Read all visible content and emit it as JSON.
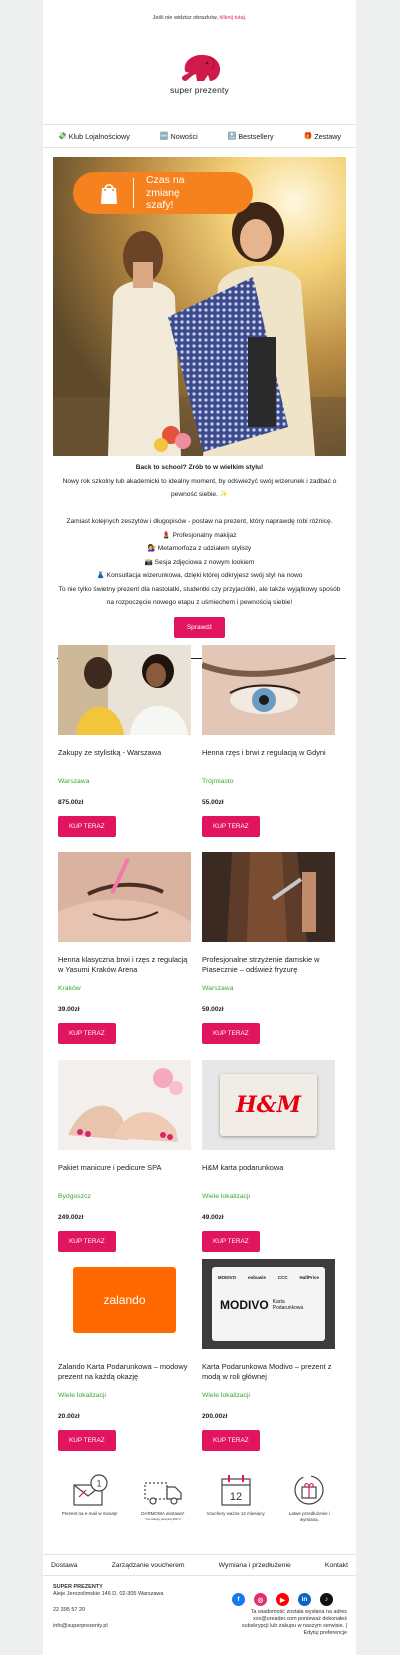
{
  "preheader": {
    "text": "Jeśli nie widzisz obrazków,",
    "link": "kliknij tutaj."
  },
  "brand": {
    "name": "super prezenty"
  },
  "nav": [
    {
      "icon": "💸",
      "label": "Klub Lojalnościowy"
    },
    {
      "icon": "🆕",
      "label": "Nowości"
    },
    {
      "icon": "🔝",
      "label": "Bestsellery"
    },
    {
      "icon": "🎁",
      "label": "Zestawy"
    }
  ],
  "hero": {
    "headline": "Czas na zmianę szafy!"
  },
  "intro": {
    "heading": "Back to school? Zrób to w wielkim stylu!",
    "p1": "Nowy rok szkolny lub akademicki to idealny moment, by odświeżyć swój wizerunek i zadbać o pewność siebie. ✨",
    "p2": "Zamiast kolejnych zeszytów i długopisów - postaw na prezent, który naprawdę robi różnicę.",
    "items": [
      "💄 Profesjonalny makijaż",
      "💇‍♀️ Metamorfoza z udziałem stylisty",
      "📸 Sesja zdjęciowa z nowym lookiem",
      "👗 Konsultacja wizerunkowa, dzięki której odkryjesz swój styl na nowo"
    ],
    "p3": "To nie tylko świetny prezent dla nastolatki, studentki czy przyjaciółki, ale  także wyjątkowy sposób na rozpoczęcie nowego etapu z uśmiechem i pewnością siebie!",
    "cta": "Sprawdź"
  },
  "products": [
    {
      "title": "Zakupy ze stylistką - Warszawa",
      "location": "Warszawa",
      "price": "875.00zł",
      "cta": "KUP TERAZ"
    },
    {
      "title": "Henna rzęs i brwi z regulacją w Gdyni",
      "location": "Trójmiasto",
      "price": "55.00zł",
      "cta": "KUP TERAZ"
    },
    {
      "title": "Henna klasyczna brwi i rzęs z regulacją w Yasumi Kraków Arena",
      "location": "Kraków",
      "price": "39.00zł",
      "cta": "KUP TERAZ"
    },
    {
      "title": "Profesjonalne strzyżenie damskie w Piasecznie – odśwież fryzurę",
      "location": "Warszawa",
      "price": "59.00zł",
      "cta": "KUP TERAZ"
    },
    {
      "title": "Pakiet manicure i pedicure SPA",
      "location": "Bydgoszcz",
      "price": "249.00zł",
      "cta": "KUP TERAZ"
    },
    {
      "title": "H&M karta podarunkowa",
      "location": "Wiele lokalizacji",
      "price": "49.00zł",
      "cta": "KUP TERAZ"
    },
    {
      "title": "Zalando Karta Podarunkowa – modowy prezent na każdą okazję",
      "location": "Wiele lokalizacji",
      "price": "20.00zł",
      "cta": "KUP TERAZ"
    },
    {
      "title": "Karta Podarunkowa Modivo – prezent z modą w roli głównej",
      "location": "Wiele lokalizacji",
      "price": "200.00zł",
      "cta": "KUP TERAZ"
    }
  ],
  "logos": {
    "hm": "H&M",
    "zalando": "zalando",
    "modivo": "MODIVO",
    "modivo_sub": "Karta Podarunkowa",
    "modivo_brands": [
      "MODIVO",
      "eobuwie",
      "CCC",
      "HalfPrice"
    ]
  },
  "features": [
    {
      "label": "Prezent na e-mail w minutę!",
      "badge": "1"
    },
    {
      "label": "DARMOWA dostawa*",
      "note": "*na zakupy powyżej 200 zł"
    },
    {
      "label": "Vouchery ważne 12 miesięcy.",
      "badge": "12"
    },
    {
      "label": "Łatwe przedłużenie i wymiana."
    }
  ],
  "footer_nav": [
    "Dostawa",
    "Zarządzanie voucherem",
    "Wymiana i przedłużenie",
    "Kontakt"
  ],
  "company": {
    "name": "SUPER PREZENTY",
    "address": "Aleje Jerozolimskie 146 D, 02-305 Warszawa",
    "phone": "22 395 57 20",
    "email": "info@superprezenty.pl"
  },
  "legal": "Ta wiadomość została wysłana na adres xxx@ureader.com ponieważ dokonałeś subskrypcji lub zakupu w naszym serwisie. | Edytuj preferencje",
  "colors": {
    "brand": "#e1155f",
    "accent_orange": "#f5821f",
    "location_green": "#3aa63a"
  }
}
